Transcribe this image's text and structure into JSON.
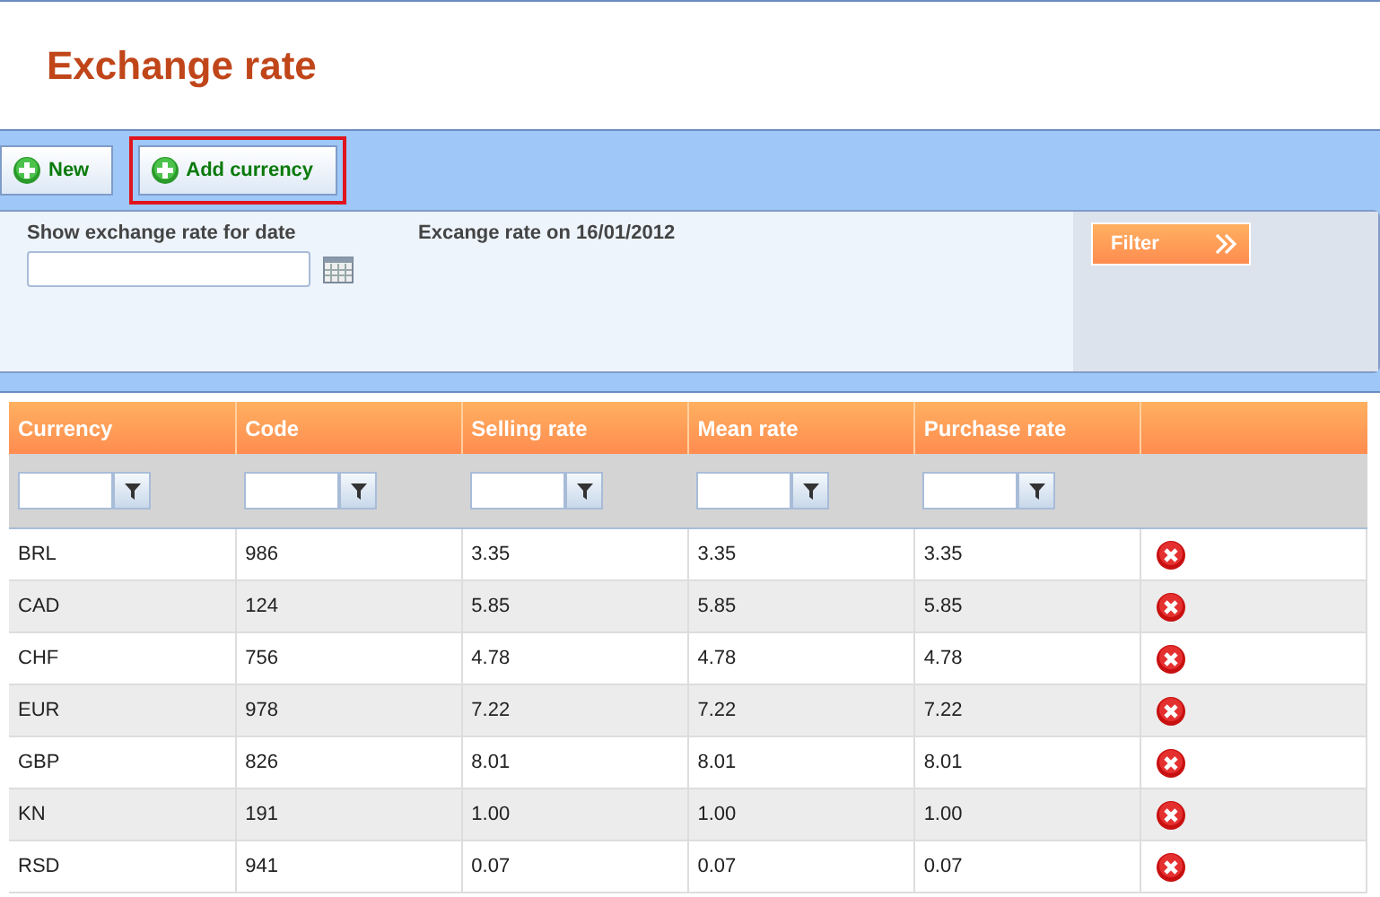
{
  "page_title": "Exchange rate",
  "toolbar": {
    "buttons": [
      {
        "label": "New",
        "highlighted": false
      },
      {
        "label": "Add currency",
        "highlighted": true
      }
    ]
  },
  "filter_panel": {
    "date_label": "Show exchange rate for date",
    "date_value_heading": "Excange rate on 16/01/2012",
    "filter_button": "Filter"
  },
  "table": {
    "columns": [
      "Currency",
      "Code",
      "Selling rate",
      "Mean rate",
      "Purchase rate"
    ],
    "rows": [
      [
        "BRL",
        "986",
        "3.35",
        "3.35",
        "3.35"
      ],
      [
        "CAD",
        "124",
        "5.85",
        "5.85",
        "5.85"
      ],
      [
        "CHF",
        "756",
        "4.78",
        "4.78",
        "4.78"
      ],
      [
        "EUR",
        "978",
        "7.22",
        "7.22",
        "7.22"
      ],
      [
        "GBP",
        "826",
        "8.01",
        "8.01",
        "8.01"
      ],
      [
        "KN",
        "191",
        "1.00",
        "1.00",
        "1.00"
      ],
      [
        "RSD",
        "941",
        "0.07",
        "0.07",
        "0.07"
      ]
    ]
  }
}
